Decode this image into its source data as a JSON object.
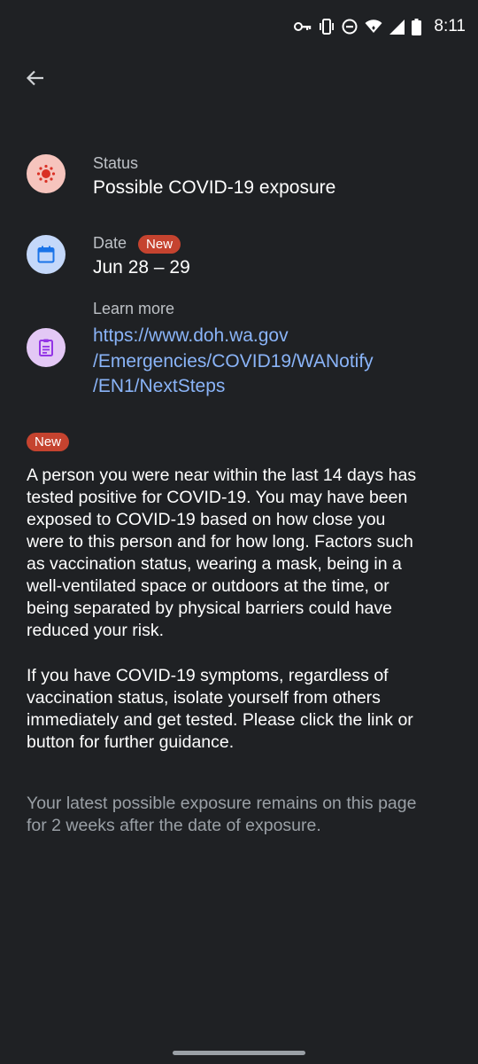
{
  "status_bar": {
    "time": "8:11",
    "icons": [
      "vpn-key-icon",
      "vibrate-icon",
      "do-not-disturb-icon",
      "wifi-icon",
      "signal-icon",
      "battery-icon"
    ]
  },
  "header": {
    "back_icon": "arrow-back-icon"
  },
  "status_row": {
    "label": "Status",
    "value": "Possible COVID-19 exposure",
    "icon": "virus-icon"
  },
  "date_row": {
    "label": "Date",
    "badge": "New",
    "value": "Jun 28 – 29",
    "icon": "calendar-icon"
  },
  "learn_more_row": {
    "label": "Learn more",
    "link_lines": [
      "https://www.doh.wa.gov",
      "/Emergencies/COVID19/WANotify",
      "/EN1/NextSteps"
    ],
    "icon": "clipboard-icon"
  },
  "message": {
    "badge": "New",
    "paragraph1_lines": [
      "A person you were near within the last 14 days has",
      "tested positive for COVID-19. You may have been",
      "exposed to COVID-19 based on how close you",
      "were to this person and for how long. Factors such",
      "as vaccination status, wearing a mask, being in a",
      "well-ventilated space or outdoors at the time, or",
      "being separated by physical barriers could have",
      "reduced your risk."
    ],
    "paragraph2_lines": [
      "If you have COVID-19 symptoms, regardless of",
      "vaccination status, isolate yourself from others",
      "immediately and get tested. Please click the link or",
      "button for further guidance."
    ]
  },
  "footer": {
    "lines": [
      "Your latest possible exposure remains on this page",
      "for 2 weeks after the date of exposure."
    ]
  },
  "colors": {
    "background": "#1f2124",
    "link": "#8ab4f8",
    "badge": "#c5432f",
    "status_icon_bg": "#f6c4bd",
    "status_icon_fg": "#d93025",
    "date_icon_bg": "#c4d8fa",
    "date_icon_fg": "#1a73e8",
    "learn_icon_bg": "#e3c8f5",
    "learn_icon_fg": "#9334e6"
  }
}
